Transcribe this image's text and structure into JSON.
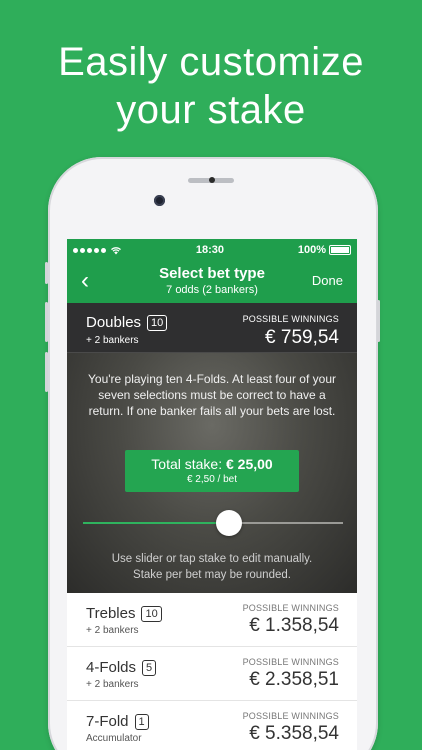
{
  "headline": {
    "line1": "Easily customize",
    "line2": "your stake"
  },
  "status_bar": {
    "time": "18:30",
    "battery": "100%"
  },
  "nav": {
    "back": "‹",
    "title": "Select bet type",
    "subtitle": "7 odds (2 bankers)",
    "done": "Done"
  },
  "selected_bet": {
    "name": "Doubles",
    "count": "10",
    "bankers": "+ 2 bankers",
    "winnings_label": "POSSIBLE WINNINGS",
    "winnings": "€ 759,54"
  },
  "detail": {
    "info": "You're playing ten 4-Folds. At least four of your seven selections must be correct to have a return. If one banker fails all your bets are lost.",
    "stake_label": "Total stake: ",
    "stake_value": "€ 25,00",
    "stake_per_bet": "€ 2,50 / bet",
    "slider_level": 0.56,
    "hint_line1": "Use slider or tap stake to edit manually.",
    "hint_line2": "Stake per bet may be rounded."
  },
  "options": [
    {
      "name": "Trebles",
      "count": "10",
      "bankers": "+ 2 bankers",
      "winnings_label": "POSSIBLE WINNINGS",
      "winnings": "€ 1.358,54"
    },
    {
      "name": "4-Folds",
      "count": "5",
      "bankers": "+ 2 bankers",
      "winnings_label": "POSSIBLE WINNINGS",
      "winnings": "€ 2.358,51"
    },
    {
      "name": "7-Fold",
      "count": "1",
      "bankers": "Accumulator",
      "winnings_label": "POSSIBLE WINNINGS",
      "winnings": "€ 5.358,54"
    }
  ],
  "colors": {
    "brand_green": "#2fae5a",
    "nav_green": "#1f9e4c",
    "button_green": "#24a551"
  }
}
